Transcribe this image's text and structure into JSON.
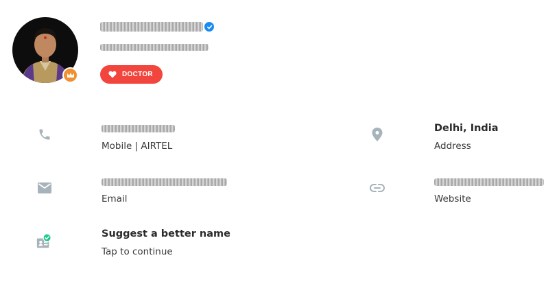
{
  "profile": {
    "tag_label": "DOCTOR",
    "colors": {
      "tag": "#f2453d",
      "verified": "#1a8cf0",
      "premium": "#f0902f",
      "icon": "#a7b3bb"
    }
  },
  "contacts": {
    "phone": {
      "label": "Mobile | AIRTEL",
      "icon": "phone-icon"
    },
    "location": {
      "value": "Delhi, India",
      "label": "Address",
      "icon": "location-pin-icon"
    },
    "email": {
      "label": "Email",
      "icon": "email-icon"
    },
    "website": {
      "label": "Website",
      "icon": "link-icon"
    },
    "suggest": {
      "title": "Suggest a better name",
      "subtitle": "Tap to continue",
      "icon": "contact-card-verified-icon"
    }
  }
}
